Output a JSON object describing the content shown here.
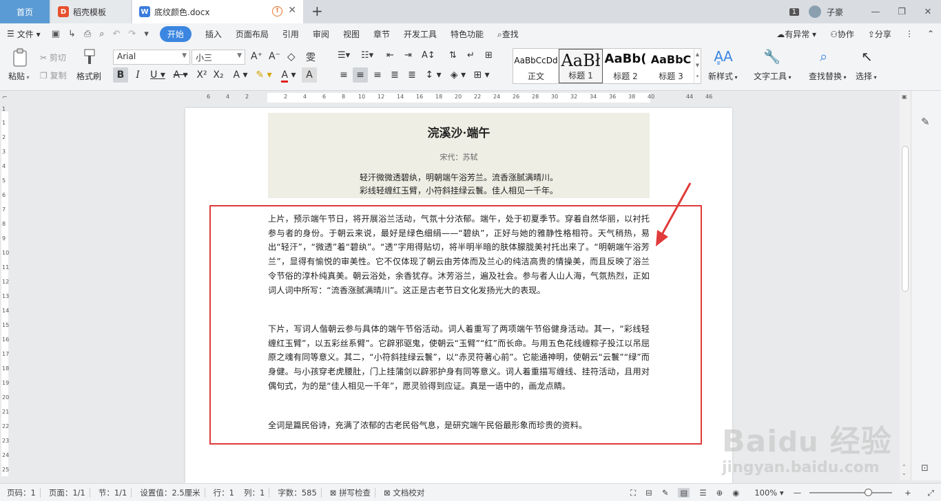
{
  "tabs": {
    "home": "首页",
    "template": "稻壳模板",
    "doc": "底纹颜色.docx"
  },
  "titlebar": {
    "window_count": "1",
    "user": "子豪"
  },
  "menu": {
    "file": "文件",
    "items": [
      "开始",
      "插入",
      "页面布局",
      "引用",
      "审阅",
      "视图",
      "章节",
      "开发工具",
      "特色功能"
    ],
    "search": "查找",
    "right": [
      "有异常",
      "协作",
      "分享"
    ]
  },
  "ribbon": {
    "paste": "粘贴",
    "cut": "剪切",
    "copy": "复制",
    "format_painter": "格式刷",
    "font_name": "Arial",
    "font_size": "小三",
    "styles": [
      {
        "preview": "AaBbCcDd",
        "label": "正文"
      },
      {
        "preview": "AaBł",
        "label": "标题 1"
      },
      {
        "preview": "AaBb(",
        "label": "标题 2"
      },
      {
        "preview": "AaBbC",
        "label": "标题 3"
      }
    ],
    "new_style": "新样式",
    "text_tools": "文字工具",
    "find_replace": "查找替换",
    "select": "选择"
  },
  "ruler": {
    "h_ticks": [
      "6",
      "4",
      "2",
      "2",
      "4",
      "6",
      "8",
      "10",
      "12",
      "14",
      "16",
      "18",
      "20",
      "22",
      "24",
      "26",
      "28",
      "30",
      "32",
      "34",
      "36",
      "38",
      "40",
      "44",
      "46"
    ],
    "v_ticks": [
      "1",
      "1",
      "2",
      "3",
      "4",
      "5",
      "6",
      "7",
      "8",
      "9",
      "10",
      "11",
      "12",
      "13",
      "14",
      "15",
      "16",
      "17",
      "18",
      "19",
      "20",
      "21",
      "22",
      "23",
      "24",
      "25"
    ]
  },
  "document": {
    "poem_title": "浣溪沙·端午",
    "poem_author": "宋代：苏轼",
    "poem_line1": "轻汗微微透碧纨，明朝端午浴芳兰。流香涨腻满晴川。",
    "poem_line2": "彩线轻缠红玉臂，小符斜挂绿云鬟。佳人相见一千年。",
    "para1": "上片，预示端午节日，将开展浴兰活动，气氛十分浓郁。端午，处于初夏季节。穿着自然华丽，以衬托参与者的身份。于朝云来说，最好是绿色细绢——“碧纨”，正好与她的雅静性格相符。天气稍热，易出“轻汗”，“微透”着“碧纨”。“透”字用得贴切，将半明半暗的肤体朦胧美衬托出来了。“明朝端午浴芳兰”，显得有愉悦的审美性。它不仅体现了朝云由芳体而及兰心的纯洁高贵的情操美，而且反映了浴兰令节俗的淳朴纯真美。朝云浴处，余香犹存。沐芳浴兰，遍及社会。参与者人山人海，气氛热烈，正如词人词中所写：“流香涨腻满晴川”。这正是古老节日文化发扬光大的表现。",
    "para2": "下片，写词人偕朝云参与具体的端午节俗活动。词人着重写了两项端午节俗健身活动。其一，“彩线轻缠红玉臂”，以五彩丝系臂”。它辟邪驱鬼，使朝云“玉臂”“红”而长命。与用五色花线缠粽子投江以吊屈原之魂有同等意义。其二，“小符斜挂绿云鬟”，以“赤灵符著心前”。它能通神明，使朝云“云鬟”“绿”而身健。与小孩穿老虎腰肚，门上挂蒲剑以辟邪护身有同等意义。词人着重描写缠线、挂符活动，且用对偶句式，为的是“佳人相见一千年”，愿灵验得到应证。真是一语中的，画龙点睛。",
    "para3": "全词是篇民俗诗，充满了浓郁的古老民俗气息，是研究端午民俗最形象而珍贵的资料。"
  },
  "status": {
    "page_num": "页码：1",
    "page_of": "页面：1/1",
    "section": "节：1/1",
    "setting": "设置值：2.5厘米",
    "row": "行：1",
    "col": "列：1",
    "word_count": "字数：585",
    "spell_check": "拼写检查",
    "doc_check": "文档校对",
    "zoom": "100%"
  },
  "watermark": {
    "brand": "Bai",
    "brand2": "经验",
    "url": "jingyan.baidu.com"
  },
  "colors": {
    "accent": "#3b86e0",
    "highlight_border": "#e03a3a",
    "poem_shading": "#efeee4"
  }
}
